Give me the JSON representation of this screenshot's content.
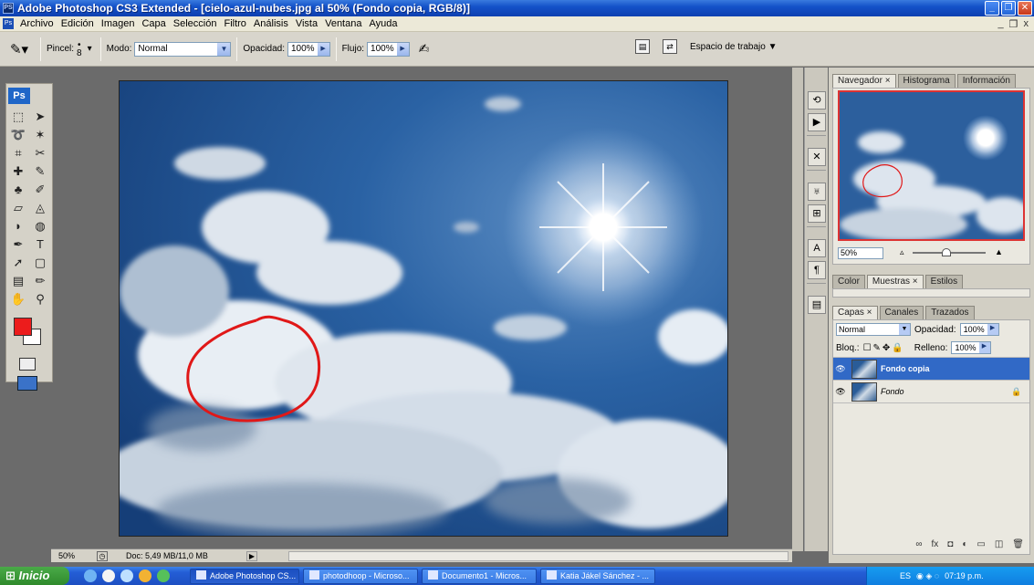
{
  "window": {
    "app_icon": "PS",
    "title": "Adobe Photoshop CS3 Extended - [cielo-azul-nubes.jpg al 50% (Fondo copia, RGB/8)]",
    "minimize": "_",
    "restore": "❐",
    "close": "✕"
  },
  "menu": {
    "items": [
      "Archivo",
      "Edición",
      "Imagen",
      "Capa",
      "Selección",
      "Filtro",
      "Análisis",
      "Vista",
      "Ventana",
      "Ayuda"
    ],
    "doc_minimize": "_",
    "doc_restore": "❐",
    "doc_close": "x"
  },
  "options": {
    "brush_label": "Pincel:",
    "brush_size": "8",
    "mode_label": "Modo:",
    "mode_value": "Normal",
    "opacity_label": "Opacidad:",
    "opacity_value": "100%",
    "flow_label": "Flujo:",
    "flow_value": "100%",
    "workspace_label": "Espacio de trabajo ▼"
  },
  "toolbox": {
    "badge": "Ps",
    "tools": [
      "marquee",
      "move",
      "lasso",
      "magic-wand",
      "crop",
      "slice",
      "spot-healing",
      "brush",
      "clone-stamp",
      "history-brush",
      "eraser",
      "paint-bucket",
      "blur",
      "dodge",
      "pen",
      "type",
      "path-selection",
      "rectangle",
      "notes",
      "eyedropper",
      "hand",
      "zoom"
    ],
    "foreground_color": "#ec1c1c",
    "background_color": "#ffffff"
  },
  "status": {
    "zoom": "50%",
    "doc_info": "Doc: 5,49 MB/11,0 MB"
  },
  "navigator_panel": {
    "tabs": [
      "Navegador ×",
      "Histograma",
      "Información"
    ],
    "zoom_value": "50%"
  },
  "swatches_panel": {
    "tabs": [
      "Color",
      "Muestras ×",
      "Estilos"
    ]
  },
  "layers_panel": {
    "tabs": [
      "Capas ×",
      "Canales",
      "Trazados"
    ],
    "blend_mode": "Normal",
    "opacity_label": "Opacidad:",
    "opacity_value": "100%",
    "lock_label": "Bloq.:",
    "fill_label": "Relleno:",
    "fill_value": "100%",
    "layers": [
      {
        "name": "Fondo copia",
        "selected": true
      },
      {
        "name": "Fondo",
        "selected": false,
        "locked": true
      }
    ]
  },
  "taskbar": {
    "start_label": "Inicio",
    "tasks": [
      "Adobe Photoshop CS...",
      "photodhoop - Microso...",
      "Documento1 - Micros...",
      "Katia Jákel Sánchez - ..."
    ],
    "tray_lang": "ES",
    "clock": "07:19 p.m."
  },
  "annotation": {
    "circle_color": "#e01818"
  }
}
